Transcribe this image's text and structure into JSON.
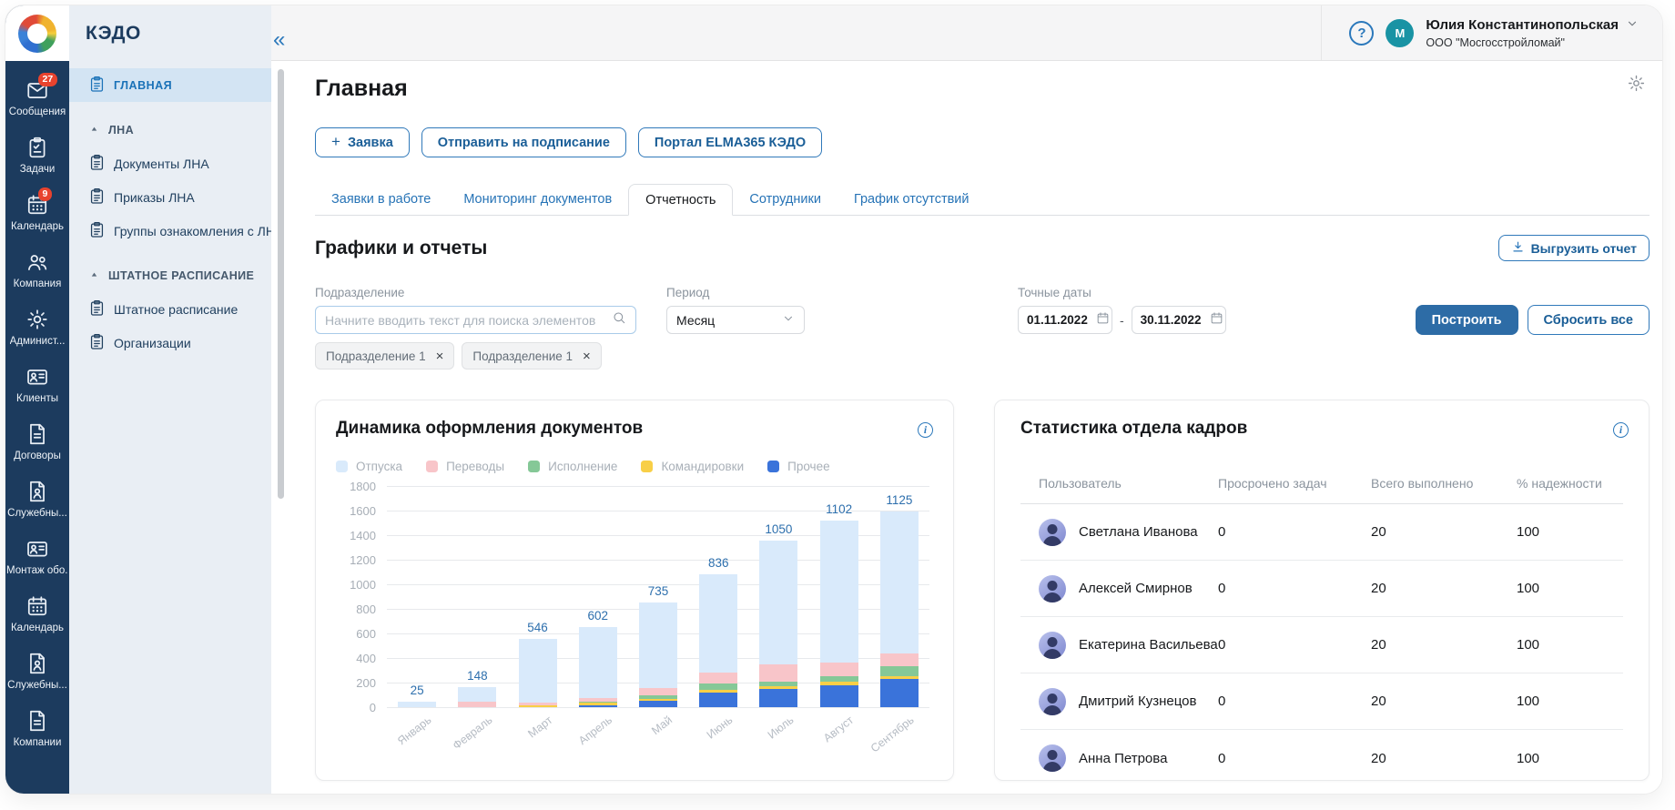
{
  "sidebar": {
    "title": "КЭДО",
    "collapse_icon": "«",
    "items": [
      {
        "key": "home",
        "type": "item",
        "label": "ГЛАВНАЯ",
        "icon": "doc-list-icon",
        "active": true
      },
      {
        "key": "lna-section",
        "type": "section",
        "label": "ЛНА"
      },
      {
        "key": "lna-docs",
        "type": "item",
        "label": "Документы ЛНА",
        "icon": "doc-list-icon"
      },
      {
        "key": "lna-orders",
        "type": "item",
        "label": "Приказы ЛНА",
        "icon": "doc-list-icon"
      },
      {
        "key": "lna-groups",
        "type": "item",
        "label": "Группы ознакомления с ЛНА",
        "icon": "doc-list-icon"
      },
      {
        "key": "staffing-section",
        "type": "section",
        "label": "ШТАТНОЕ РАСПИСАНИЕ"
      },
      {
        "key": "staffing",
        "type": "item",
        "label": "Штатное расписание",
        "icon": "doc-list-icon"
      },
      {
        "key": "organizations",
        "type": "item",
        "label": "Организации",
        "icon": "doc-list-icon"
      }
    ]
  },
  "rail": {
    "items": [
      {
        "key": "messages",
        "label": "Сообщения",
        "icon": "mail-icon",
        "badge": "27"
      },
      {
        "key": "tasks",
        "label": "Задачи",
        "icon": "tasks-icon"
      },
      {
        "key": "calendar",
        "label": "Календарь",
        "icon": "calendar-icon",
        "badge": "9"
      },
      {
        "key": "company",
        "label": "Компания",
        "icon": "people-icon"
      },
      {
        "key": "administration",
        "label": "Админист...",
        "icon": "gear-icon"
      },
      {
        "key": "clients",
        "label": "Клиенты",
        "icon": "id-card-icon"
      },
      {
        "key": "contracts",
        "label": "Договоры",
        "icon": "document-icon"
      },
      {
        "key": "memos",
        "label": "Служебны...",
        "icon": "document-person-icon"
      },
      {
        "key": "equipment",
        "label": "Монтаж обо..",
        "icon": "id-card-icon"
      },
      {
        "key": "calendar-2",
        "label": "Календарь",
        "icon": "calendar-icon"
      },
      {
        "key": "memos-2",
        "label": "Служебны...",
        "icon": "document-person-icon"
      },
      {
        "key": "companies",
        "label": "Компании",
        "icon": "document-icon"
      }
    ]
  },
  "topbar": {
    "user": {
      "initial": "M",
      "name": "Юлия Константинопольская",
      "company": "ООО \"Мосгосстройломай\""
    }
  },
  "page": {
    "title": "Главная",
    "actions": [
      {
        "key": "new-request",
        "label": "Заявка",
        "has_plus": true
      },
      {
        "key": "send-for-signing",
        "label": "Отправить на подписание"
      },
      {
        "key": "portal",
        "label": "Портал ELMA365 КЭДО"
      }
    ],
    "tabs": [
      {
        "key": "requests",
        "label": "Заявки в работе"
      },
      {
        "key": "monitoring",
        "label": "Мониторинг документов"
      },
      {
        "key": "reports",
        "label": "Отчетность",
        "active": true
      },
      {
        "key": "employees",
        "label": "Сотрудники"
      },
      {
        "key": "absence",
        "label": "График отсутствий"
      }
    ]
  },
  "reports": {
    "title": "Графики и отчеты",
    "export_label": "Выгрузить отчет",
    "filters": {
      "department": {
        "label": "Подразделение",
        "placeholder": "Начните вводить текст для поиска элементов",
        "chips": [
          "Подразделение 1",
          "Подразделение 1"
        ]
      },
      "period": {
        "label": "Период",
        "value": "Месяц"
      },
      "dates": {
        "label": "Точные даты",
        "from": "01.11.2022",
        "to": "30.11.2022",
        "separator": "-"
      },
      "build_label": "Построить",
      "reset_label": "Сбросить все"
    }
  },
  "chart_data": {
    "type": "bar",
    "stacked": true,
    "title": "Динамика оформления документов",
    "categories": [
      "Январь",
      "Февраль",
      "Март",
      "Апрель",
      "Май",
      "Июнь",
      "Июль",
      "Август",
      "Сентябрь"
    ],
    "series": [
      {
        "name": "Отпуска",
        "color": "#d9eafb",
        "values": [
          45,
          115,
          515,
          580,
          700,
          800,
          1010,
          1155,
          1150
        ]
      },
      {
        "name": "Переводы",
        "color": "#f8c5c9",
        "values": [
          0,
          45,
          25,
          28,
          55,
          90,
          135,
          115,
          110
        ]
      },
      {
        "name": "Исполнение",
        "color": "#85c897",
        "values": [
          0,
          0,
          0,
          10,
          30,
          50,
          40,
          45,
          75
        ]
      },
      {
        "name": "Командировки",
        "color": "#f8cf47",
        "values": [
          0,
          0,
          15,
          18,
          15,
          20,
          25,
          30,
          25
        ]
      },
      {
        "name": "Прочее",
        "color": "#3a73da",
        "values": [
          0,
          0,
          0,
          18,
          55,
          120,
          145,
          175,
          230
        ]
      }
    ],
    "stack_order_bottom_to_top": [
      "Прочее",
      "Командировки",
      "Исполнение",
      "Переводы",
      "Отпуска"
    ],
    "bar_labels": [
      "25",
      "148",
      "546",
      "602",
      "735",
      "836",
      "1050",
      "1102",
      "1125"
    ],
    "yticks": [
      0,
      200,
      400,
      600,
      800,
      1000,
      1200,
      1400,
      1600,
      1800
    ],
    "ylim": [
      0,
      1800
    ],
    "xlabel": "",
    "ylabel": "",
    "grid": true,
    "legend_position": "top"
  },
  "stats_table": {
    "title": "Статистика отдела кадров",
    "columns": [
      "Пользователь",
      "Просрочено задач",
      "Всего выполнено",
      "% надежности"
    ],
    "rows": [
      {
        "name": "Светлана Иванова",
        "overdue": "0",
        "completed": "20",
        "reliability": "100"
      },
      {
        "name": "Алексей Смирнов",
        "overdue": "0",
        "completed": "20",
        "reliability": "100"
      },
      {
        "name": "Екатерина Васильева",
        "overdue": "0",
        "completed": "20",
        "reliability": "100"
      },
      {
        "name": "Дмитрий Кузнецов",
        "overdue": "0",
        "completed": "20",
        "reliability": "100"
      },
      {
        "name": "Анна Петрова",
        "overdue": "0",
        "completed": "20",
        "reliability": "100"
      }
    ]
  },
  "colors": {
    "accent": "#2b78bb",
    "primary_button": "#2d6ca6",
    "rail_bg": "#1c3b5e",
    "sidebar_bg": "#e9eef4",
    "active_item_bg": "#d3e4f3",
    "badge": "#e8432e",
    "avatar": "#1993a4",
    "bar_value_label": "#2d6fad"
  }
}
